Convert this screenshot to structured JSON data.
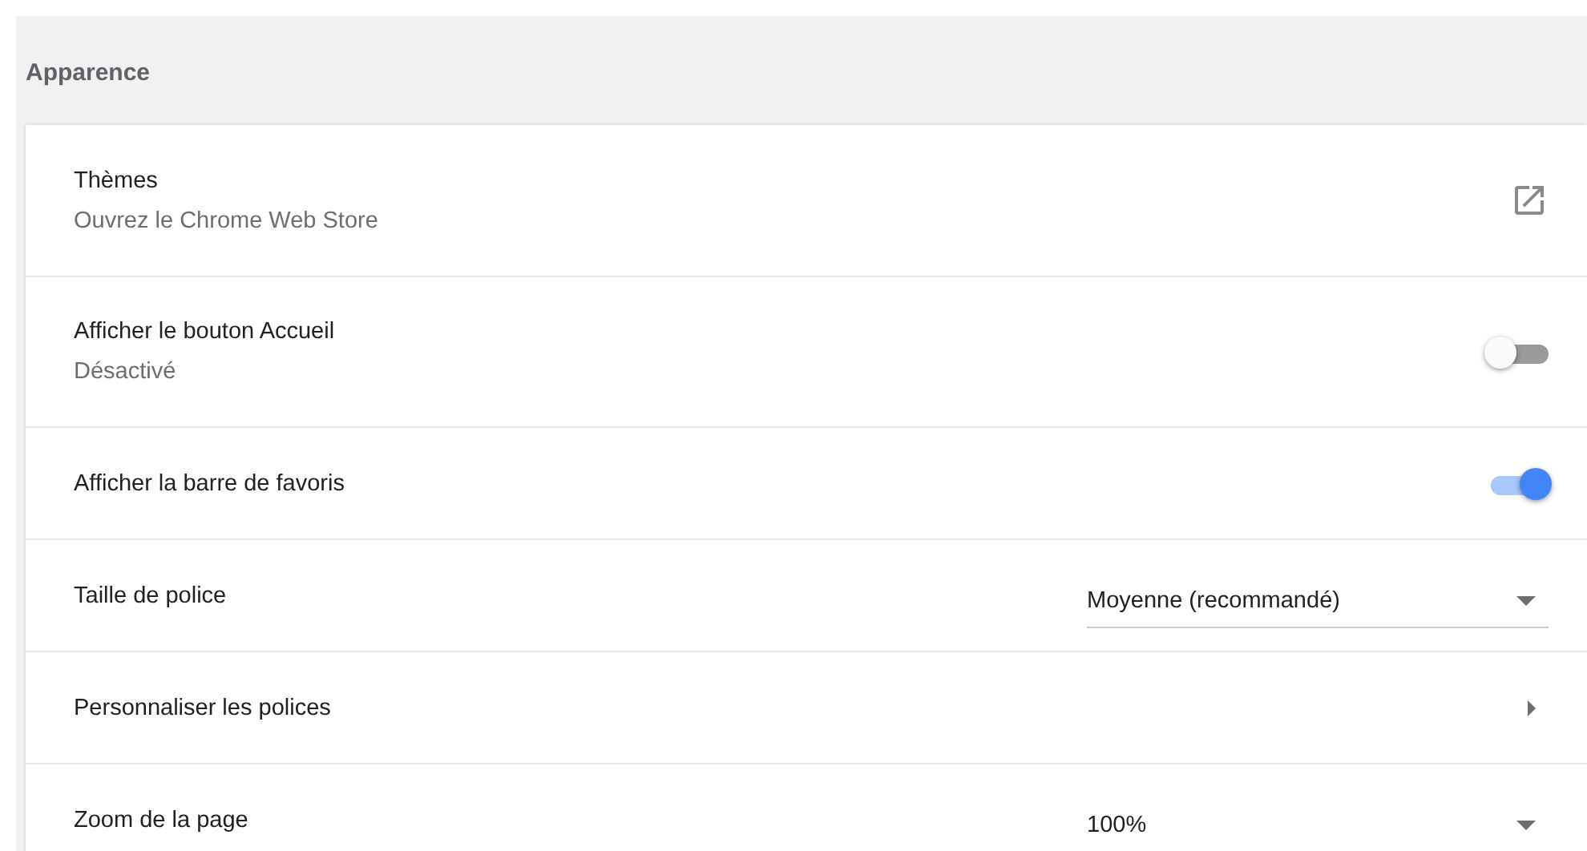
{
  "section": {
    "title": "Apparence"
  },
  "rows": [
    {
      "kind": "link",
      "label": "Thèmes",
      "sublabel": "Ouvrez le Chrome Web Store"
    },
    {
      "kind": "toggle",
      "label": "Afficher le bouton Accueil",
      "sublabel": "Désactivé",
      "on": false
    },
    {
      "kind": "toggle",
      "label": "Afficher la barre de favoris",
      "on": true
    },
    {
      "kind": "dropdown",
      "label": "Taille de police",
      "value": "Moyenne (recommandé)"
    },
    {
      "kind": "submenu",
      "label": "Personnaliser les polices"
    },
    {
      "kind": "dropdown",
      "label": "Zoom de la page",
      "value": "100%"
    }
  ]
}
